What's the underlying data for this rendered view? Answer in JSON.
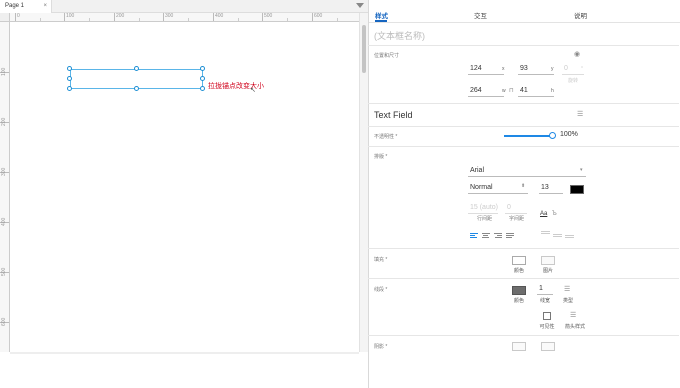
{
  "tab": {
    "label": "Page 1",
    "close": "×"
  },
  "ruler": {
    "h_ticks": [
      "0",
      "100",
      "200",
      "300",
      "400",
      "500",
      "600"
    ],
    "v_ticks": [
      "100",
      "200",
      "300",
      "400",
      "500",
      "600"
    ]
  },
  "canvas": {
    "annotation": "拉拢锚点改变大小"
  },
  "panel": {
    "tabs": [
      "样式",
      "交互",
      "说明"
    ],
    "name_placeholder": "(文本框名称)",
    "position_label": "位置和尺寸",
    "x": "124",
    "x_unit": "x",
    "y": "93",
    "y_unit": "y",
    "rotation": "0",
    "rotation_unit": "°",
    "rotation_label": "旋转",
    "w": "264",
    "w_unit": "w",
    "h": "41",
    "h_unit": "h",
    "widget_title": "Text Field",
    "opacity_label": "不透明性 *",
    "opacity_value": "100%",
    "typography_label": "排版 *",
    "font_family": "Arial",
    "font_style": "Normal",
    "font_size": "13",
    "line_spacing": "15 (auto)",
    "line_spacing_label": "行间距",
    "char_spacing": "0",
    "char_spacing_label": "字间距",
    "text_effect": "Aa",
    "fill_label": "填充 *",
    "fill_color_label": "颜色",
    "fill_image_label": "图片",
    "border_label": "线段 *",
    "border_color_label": "颜色",
    "border_width": "1",
    "border_width_label": "线宽",
    "border_type_label": "类型",
    "visibility_label": "可见性",
    "arrow_label": "箭头样式",
    "shadow_label": "阴影 *",
    "colors": {
      "accent": "#1565c0",
      "annotation": "#d0021b",
      "selection": "#5ab5e8"
    }
  }
}
